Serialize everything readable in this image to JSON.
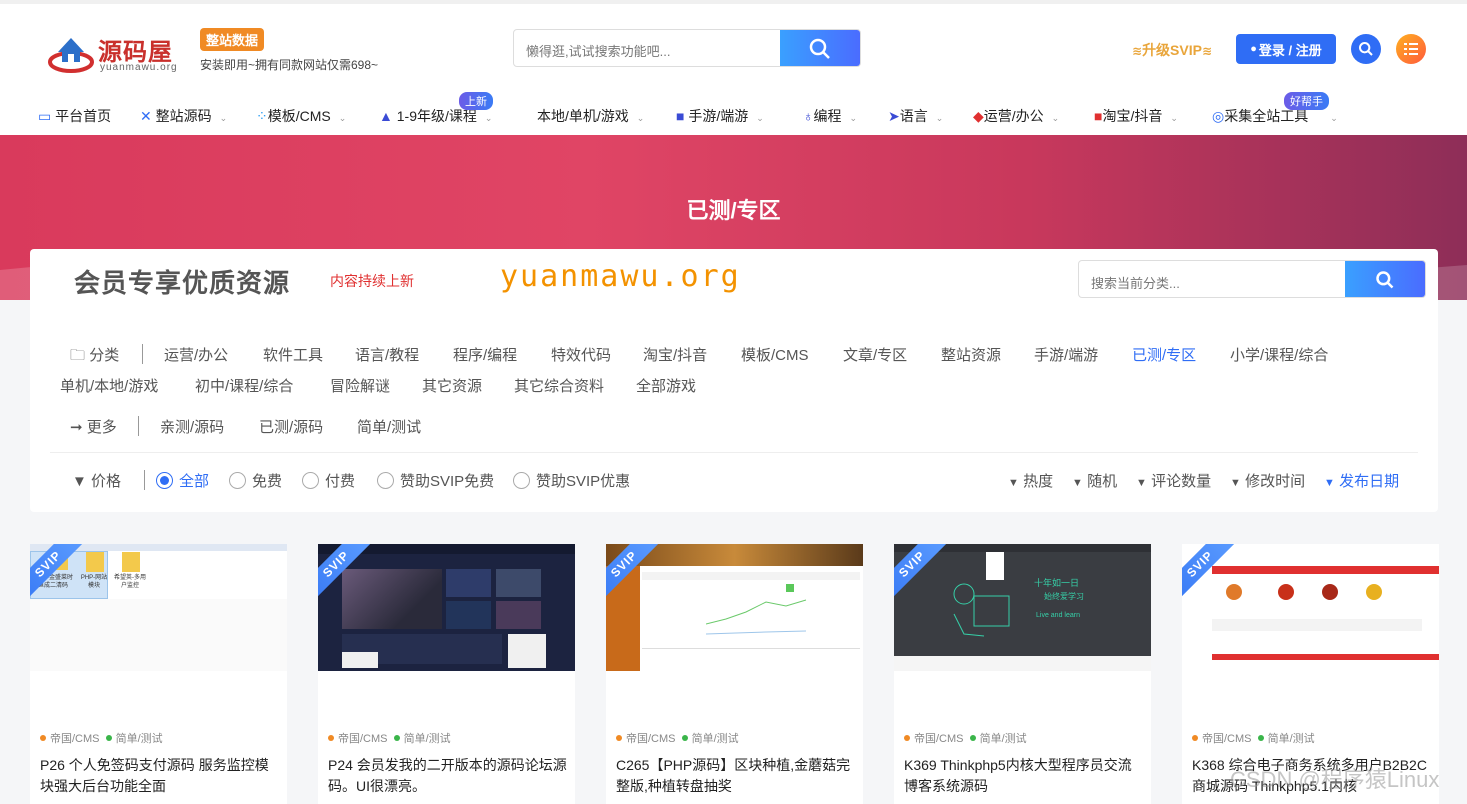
{
  "header": {
    "brand": "源码屋",
    "brand_domain": "yuanmawu.org",
    "promo_badge": "整站数据",
    "promo_sub": "安装即用~拥有同款网站仅需698~",
    "search_placeholder": "懒得逛,试试搜索功能吧...",
    "svip_label": "升级SVIP",
    "login_label": "登录 / 注册"
  },
  "nav": {
    "items": [
      {
        "label": "平台首页",
        "badge": ""
      },
      {
        "label": "整站源码",
        "badge": ""
      },
      {
        "label": "模板/CMS",
        "badge": ""
      },
      {
        "label": "1-9年级/课程",
        "badge": "上新"
      },
      {
        "label": "本地/单机/游戏",
        "badge": ""
      },
      {
        "label": "手游/端游",
        "badge": ""
      },
      {
        "label": "编程",
        "badge": ""
      },
      {
        "label": "语言",
        "badge": ""
      },
      {
        "label": "运营/办公",
        "badge": ""
      },
      {
        "label": "淘宝/抖音",
        "badge": ""
      },
      {
        "label": "采集全站工具",
        "badge": "好帮手"
      }
    ]
  },
  "banner": {
    "title": "已测/专区"
  },
  "panel": {
    "title": "会员专享优质资源",
    "subtitle": "内容持续上新",
    "domain": "yuanmawu.org",
    "search_placeholder": "搜索当前分类...",
    "category_label": "分类",
    "categories": [
      "运营/办公",
      "软件工具",
      "语言/教程",
      "程序/编程",
      "特效代码",
      "淘宝/抖音",
      "模板/CMS",
      "文章/专区",
      "整站资源",
      "手游/端游",
      "已测/专区",
      "小学/课程/综合",
      "单机/本地/游戏",
      "初中/课程/综合",
      "冒险解谜",
      "其它资源",
      "其它综合资料",
      "全部游戏"
    ],
    "active_category": "已测/专区",
    "more_label": "更多",
    "more_items": [
      "亲测/源码",
      "已测/源码",
      "简单/测试"
    ],
    "price_label": "价格",
    "price_options": [
      "全部",
      "免费",
      "付费",
      "赞助SVIP免费",
      "赞助SVIP优惠"
    ],
    "price_selected": "全部",
    "sorts": [
      "热度",
      "随机",
      "评论数量",
      "修改时间",
      "发布日期"
    ],
    "sort_active": "发布日期"
  },
  "cards": [
    {
      "ribbon": "SVIP",
      "tag1": "帝国/CMS",
      "tag2": "简单/测试",
      "title": "P26 个人免签码支付源码 服务监控模块强大后台功能全面"
    },
    {
      "ribbon": "SVIP",
      "tag1": "帝国/CMS",
      "tag2": "简单/测试",
      "title": "P24 会员发我的二开版本的源码论坛源码。UI很漂亮。"
    },
    {
      "ribbon": "SVIP",
      "tag1": "帝国/CMS",
      "tag2": "简单/测试",
      "title": "C265【PHP源码】区块种植,金蘑菇完整版,种植转盘抽奖"
    },
    {
      "ribbon": "SVIP",
      "tag1": "帝国/CMS",
      "tag2": "简单/测试",
      "title": "K369 Thinkphp5内核大型程序员交流博客系统源码"
    },
    {
      "ribbon": "SVIP",
      "tag1": "帝国/CMS",
      "tag2": "简单/测试",
      "title": "K368 综合电子商务系统多用户B2B2C商城源码 Thinkphp5.1内核"
    }
  ],
  "thumb_text": {
    "folder1": "JAVA-金盛菜时鱼成二清码",
    "folder2": "PHP-网站模块",
    "folder3": "希望英-多用户监控",
    "handwriting1": "十年如一日",
    "handwriting2": "始终爱学习",
    "handwriting3": "Live and learn"
  },
  "watermark": "CSDN @程序猿Linux",
  "colors": {
    "accent": "#2f6df5",
    "banner": "#d93a5c",
    "orange": "#f39200",
    "red": "#e03030"
  }
}
